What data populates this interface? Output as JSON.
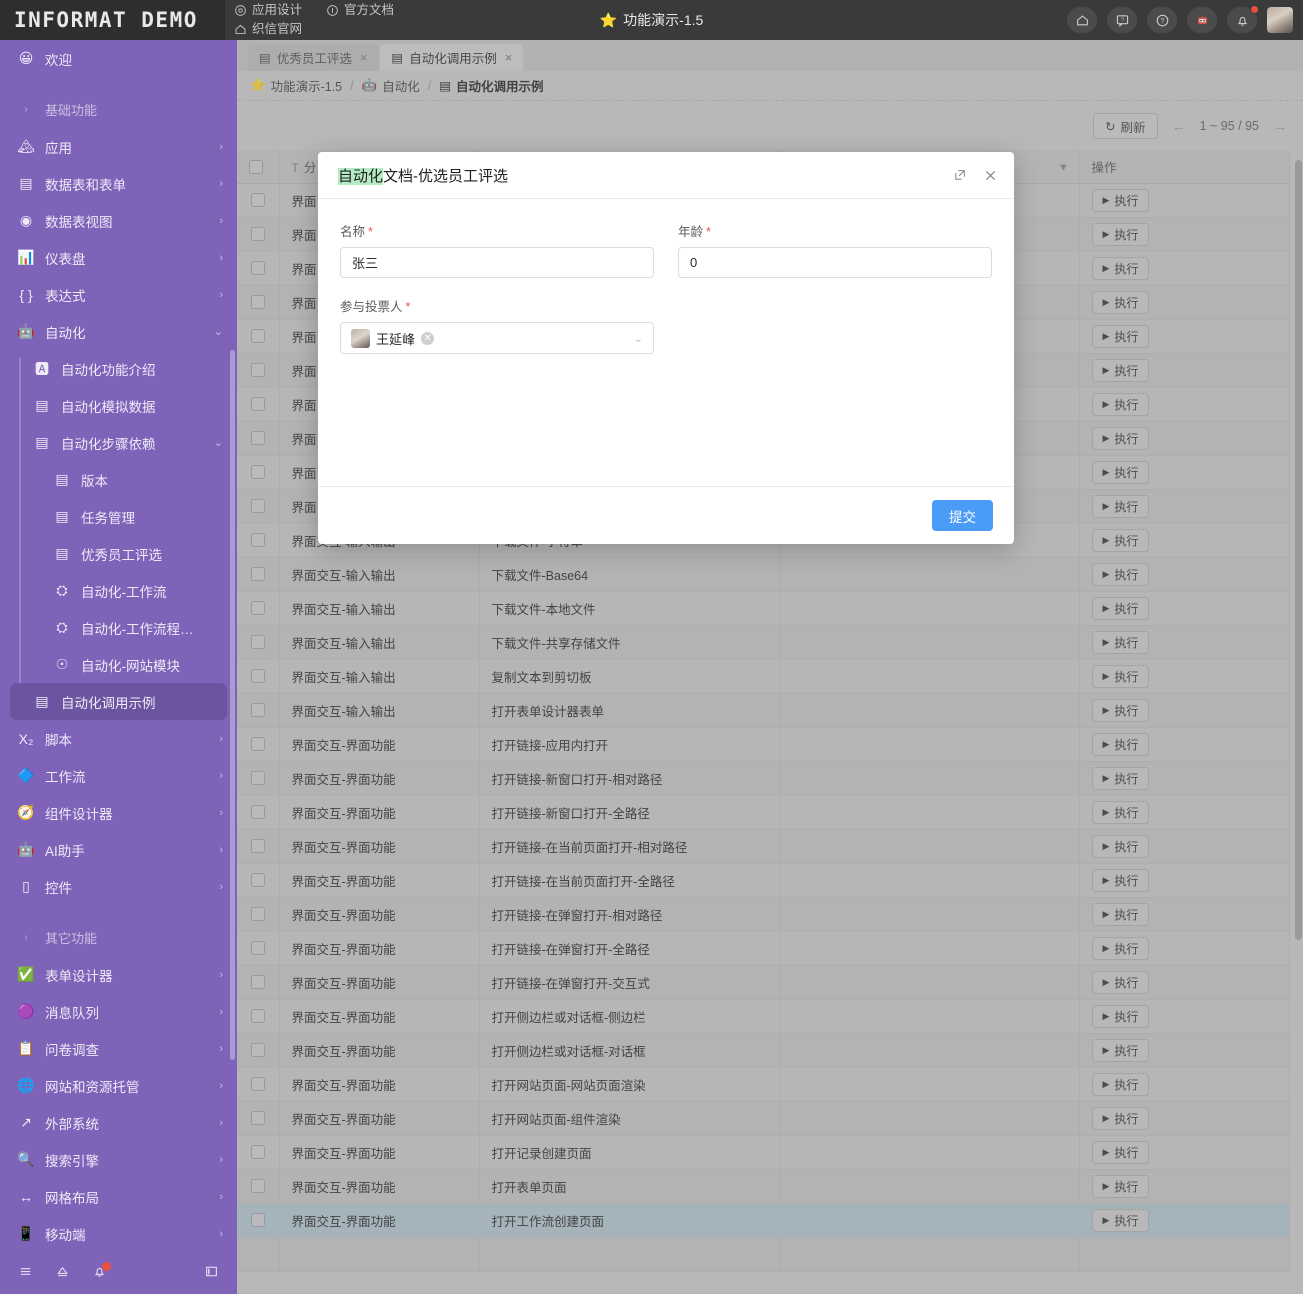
{
  "topbar": {
    "brand": "INFORMAT DEMO",
    "links": [
      {
        "label": "应用设计",
        "icon": "gear-icon"
      },
      {
        "label": "官方文档",
        "icon": "info-icon"
      },
      {
        "label": "织信官网",
        "icon": "home-icon"
      }
    ],
    "center_title": "功能演示-1.5",
    "center_star": "⭐",
    "icons": [
      {
        "name": "home-icon",
        "glyph": "⌂"
      },
      {
        "name": "feedback-icon",
        "glyph": "▣"
      },
      {
        "name": "help-icon",
        "glyph": "?"
      },
      {
        "name": "robot-icon",
        "glyph": "🤖"
      },
      {
        "name": "notification-bell-icon",
        "glyph": "🔔",
        "badge": true
      }
    ]
  },
  "sidebar": {
    "items": [
      {
        "label": "欢迎",
        "icon": "😀",
        "level": 1,
        "chevron": "",
        "type": "link"
      },
      {
        "label": "基础功能",
        "icon": "›",
        "level": 1,
        "chevron": "",
        "type": "group"
      },
      {
        "label": "应用",
        "icon": "🏔",
        "level": 1,
        "chevron": "›",
        "type": "link"
      },
      {
        "label": "数据表和表单",
        "icon": "▤",
        "level": 1,
        "chevron": "›",
        "type": "link"
      },
      {
        "label": "数据表视图",
        "icon": "◉",
        "level": 1,
        "chevron": "›",
        "type": "link"
      },
      {
        "label": "仪表盘",
        "icon": "📊",
        "level": 1,
        "chevron": "›",
        "type": "link"
      },
      {
        "label": "表达式",
        "icon": "{ }",
        "level": 1,
        "chevron": "›",
        "type": "link"
      },
      {
        "label": "自动化",
        "icon": "🤖",
        "level": 1,
        "chevron": "⌄",
        "type": "link"
      },
      {
        "label": "自动化功能介绍",
        "icon": "🅰",
        "level": 2,
        "chevron": "",
        "type": "link"
      },
      {
        "label": "自动化模拟数据",
        "icon": "▤",
        "level": 2,
        "chevron": "",
        "type": "link"
      },
      {
        "label": "自动化步骤依赖",
        "icon": "▤",
        "level": 2,
        "chevron": "⌄",
        "type": "link"
      },
      {
        "label": "版本",
        "icon": "▤",
        "level": 3,
        "chevron": "",
        "type": "link"
      },
      {
        "label": "任务管理",
        "icon": "▤",
        "level": 3,
        "chevron": "",
        "type": "link"
      },
      {
        "label": "优秀员工评选",
        "icon": "▤",
        "level": 3,
        "chevron": "",
        "type": "link"
      },
      {
        "label": "自动化-工作流",
        "icon": "⛭",
        "level": 3,
        "chevron": "",
        "type": "link"
      },
      {
        "label": "自动化-工作流程…",
        "icon": "⛭",
        "level": 3,
        "chevron": "",
        "type": "link"
      },
      {
        "label": "自动化-网站模块",
        "icon": "☉",
        "level": 3,
        "chevron": "",
        "type": "link"
      },
      {
        "label": "自动化调用示例",
        "icon": "▤",
        "level": 2,
        "chevron": "",
        "type": "link",
        "active": true
      },
      {
        "label": "脚本",
        "icon": "X₂",
        "level": 1,
        "chevron": "›",
        "type": "link"
      },
      {
        "label": "工作流",
        "icon": "🔷",
        "level": 1,
        "chevron": "›",
        "type": "link"
      },
      {
        "label": "组件设计器",
        "icon": "🧭",
        "level": 1,
        "chevron": "›",
        "type": "link"
      },
      {
        "label": "AI助手",
        "icon": "🤖",
        "level": 1,
        "chevron": "›",
        "type": "link"
      },
      {
        "label": "控件",
        "icon": "▯",
        "level": 1,
        "chevron": "›",
        "type": "link"
      },
      {
        "label": "其它功能",
        "icon": "›",
        "level": 1,
        "chevron": "",
        "type": "group"
      },
      {
        "label": "表单设计器",
        "icon": "✅",
        "level": 1,
        "chevron": "›",
        "type": "link"
      },
      {
        "label": "消息队列",
        "icon": "🟣",
        "level": 1,
        "chevron": "›",
        "type": "link"
      },
      {
        "label": "问卷调查",
        "icon": "📋",
        "level": 1,
        "chevron": "›",
        "type": "link"
      },
      {
        "label": "网站和资源托管",
        "icon": "🌐",
        "level": 1,
        "chevron": "›",
        "type": "link"
      },
      {
        "label": "外部系统",
        "icon": "↗",
        "level": 1,
        "chevron": "›",
        "type": "link"
      },
      {
        "label": "搜索引擎",
        "icon": "🔍",
        "level": 1,
        "chevron": "›",
        "type": "link"
      },
      {
        "label": "网格布局",
        "icon": "↔",
        "level": 1,
        "chevron": "›",
        "type": "link"
      },
      {
        "label": "移动端",
        "icon": "📱",
        "level": 1,
        "chevron": "›",
        "type": "link"
      }
    ],
    "footer_icons": [
      {
        "name": "menu-icon",
        "glyph": "☰"
      },
      {
        "name": "upload-icon",
        "glyph": "⌂"
      },
      {
        "name": "bell-icon",
        "glyph": "🔔",
        "badge": true
      },
      {
        "name": "collapse-panel-icon",
        "glyph": "▣"
      }
    ],
    "accent": "#7f63b8"
  },
  "tabs": [
    {
      "label": "优秀员工评选",
      "icon": "▤",
      "close": "×",
      "active": false
    },
    {
      "label": "自动化调用示例",
      "icon": "▤",
      "close": "×",
      "active": true
    }
  ],
  "breadcrumb": [
    {
      "label": "功能演示-1.5",
      "icon": "⭐"
    },
    {
      "label": "自动化",
      "icon": "🤖"
    },
    {
      "label": "自动化调用示例",
      "icon": "▤"
    }
  ],
  "breadcrumb_sep": "/",
  "toolbar": {
    "refresh_label": "刷新",
    "refresh_icon": "↻",
    "prev_arrow": "←",
    "next_arrow": "→",
    "page_range": "1 ~ 95 / 95"
  },
  "table": {
    "headers": [
      {
        "label": "",
        "icon": "",
        "name": "select-all"
      },
      {
        "label": "分",
        "icon": "T",
        "name": "column-category"
      },
      {
        "label": "",
        "icon": "",
        "name": "column-name"
      },
      {
        "label": "",
        "icon": "▾",
        "name": "column-extra"
      },
      {
        "label": "操作",
        "icon": "",
        "name": "column-actions"
      }
    ],
    "run_label": "执行",
    "run_icon": "▶",
    "rows": [
      {
        "category": "界面",
        "name": "",
        "hidden": true
      },
      {
        "category": "界面",
        "name": "",
        "hidden": true
      },
      {
        "category": "界面",
        "name": "",
        "hidden": true
      },
      {
        "category": "界面",
        "name": "",
        "hidden": true
      },
      {
        "category": "界面",
        "name": "",
        "hidden": true
      },
      {
        "category": "界面",
        "name": "",
        "hidden": true
      },
      {
        "category": "界面",
        "name": "",
        "hidden": true
      },
      {
        "category": "界面",
        "name": "",
        "hidden": true
      },
      {
        "category": "界面",
        "name": "",
        "hidden": true
      },
      {
        "category": "界面",
        "name": "",
        "hidden": true
      },
      {
        "category": "界面交互-输入输出",
        "name": "下载文件-字符串"
      },
      {
        "category": "界面交互-输入输出",
        "name": "下载文件-Base64"
      },
      {
        "category": "界面交互-输入输出",
        "name": "下载文件-本地文件"
      },
      {
        "category": "界面交互-输入输出",
        "name": "下载文件-共享存储文件"
      },
      {
        "category": "界面交互-输入输出",
        "name": "复制文本到剪切板"
      },
      {
        "category": "界面交互-输入输出",
        "name": "打开表单设计器表单"
      },
      {
        "category": "界面交互-界面功能",
        "name": "打开链接-应用内打开"
      },
      {
        "category": "界面交互-界面功能",
        "name": "打开链接-新窗口打开-相对路径"
      },
      {
        "category": "界面交互-界面功能",
        "name": "打开链接-新窗口打开-全路径"
      },
      {
        "category": "界面交互-界面功能",
        "name": "打开链接-在当前页面打开-相对路径"
      },
      {
        "category": "界面交互-界面功能",
        "name": "打开链接-在当前页面打开-全路径"
      },
      {
        "category": "界面交互-界面功能",
        "name": "打开链接-在弹窗打开-相对路径"
      },
      {
        "category": "界面交互-界面功能",
        "name": "打开链接-在弹窗打开-全路径"
      },
      {
        "category": "界面交互-界面功能",
        "name": "打开链接-在弹窗打开-交互式"
      },
      {
        "category": "界面交互-界面功能",
        "name": "打开侧边栏或对话框-侧边栏"
      },
      {
        "category": "界面交互-界面功能",
        "name": "打开侧边栏或对话框-对话框"
      },
      {
        "category": "界面交互-界面功能",
        "name": "打开网站页面-网站页面渲染"
      },
      {
        "category": "界面交互-界面功能",
        "name": "打开网站页面-组件渲染"
      },
      {
        "category": "界面交互-界面功能",
        "name": "打开记录创建页面"
      },
      {
        "category": "界面交互-界面功能",
        "name": "打开表单页面"
      },
      {
        "category": "界面交互-界面功能",
        "name": "打开工作流创建页面",
        "selected": true
      },
      {
        "category": "",
        "name": "",
        "empty": true
      }
    ]
  },
  "modal": {
    "title_highlight": "自动化",
    "title_rest": "文档-优选员工评选",
    "expand_icon": "⧉",
    "close_icon": "✕",
    "fields": [
      {
        "label": "名称",
        "required": "*",
        "value": "张三",
        "name": "name-field"
      },
      {
        "label": "年龄",
        "required": "*",
        "value": "0",
        "name": "age-field"
      }
    ],
    "voter_field": {
      "label": "参与投票人",
      "required": "*",
      "chip_name": "王延峰",
      "chip_remove": "✕",
      "chevron": "⌄"
    },
    "submit_label": "提交",
    "submit_color": "#4a9cf6"
  }
}
